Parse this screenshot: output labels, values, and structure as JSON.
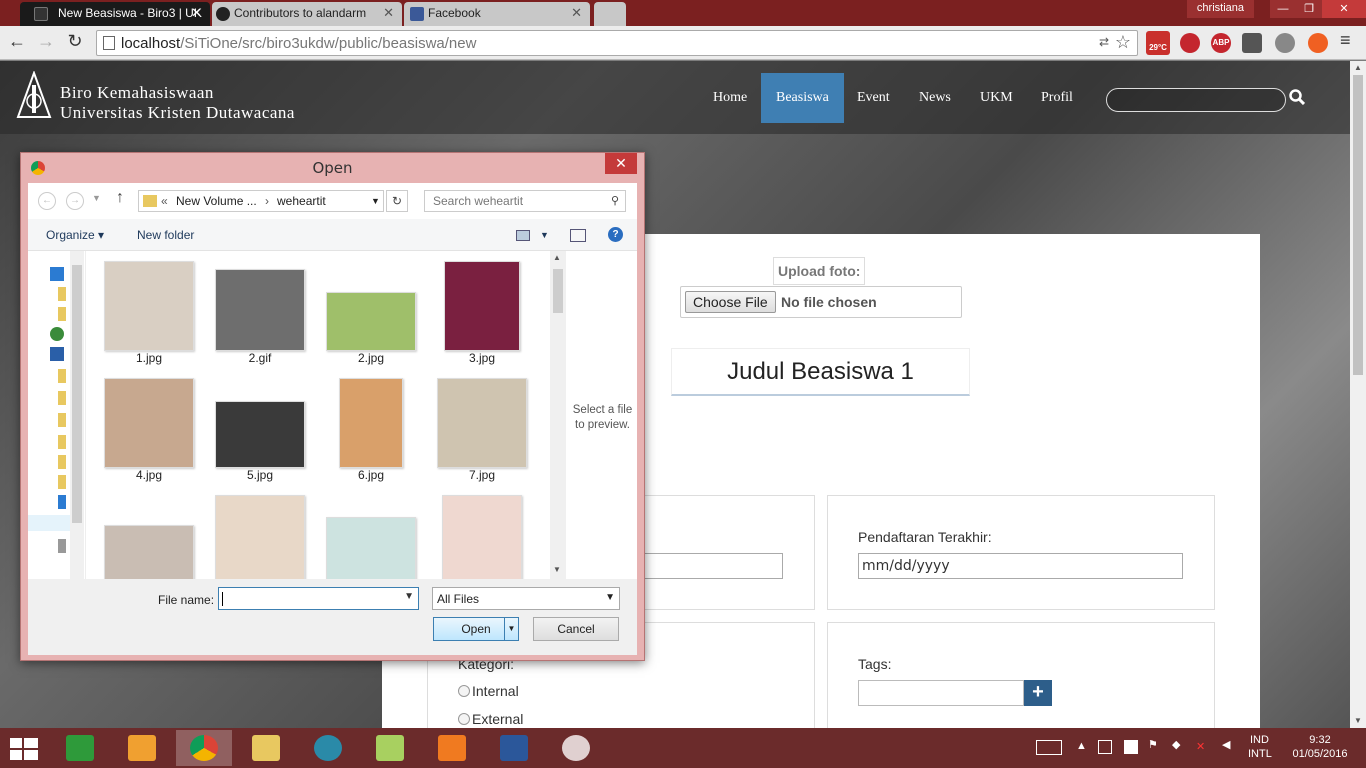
{
  "browser": {
    "tabs": [
      {
        "title": "New Beasiswa - Biro3 | UK",
        "active": true
      },
      {
        "title": "Contributors to alandarm",
        "active": false
      },
      {
        "title": "Facebook",
        "active": false
      }
    ],
    "tab_close": "✕",
    "user": "christiana",
    "window_buttons": {
      "minimize": "—",
      "restore": "❐",
      "close": "✕"
    },
    "nav": {
      "back": "←",
      "forward": "→",
      "reload": "↻"
    },
    "url_host": "localhost",
    "url_path": "/SiTiOne/src/biro3ukdw/public/beasiswa/new",
    "star": "☆",
    "translate": "⇄",
    "extensions": {
      "weather": "29°C",
      "abp": "ABP"
    },
    "menu": "≡"
  },
  "site": {
    "brand_line1": "Biro Kemahasiswaan",
    "brand_line2": "Universitas Kristen Dutawacana",
    "nav": [
      "Home",
      "Beasiswa",
      "Event",
      "News",
      "UKM",
      "Profil"
    ],
    "active_nav": "Beasiswa",
    "upload_label": "Upload foto:",
    "choose_file": "Choose File",
    "no_file": "No file chosen",
    "judul": "Judul Beasiswa 1",
    "pendaftaran_label": "Pendaftaran Terakhir:",
    "date_placeholder": "mm/dd/yyyy",
    "kategori_label": "Kategori:",
    "kategori_options": [
      "Internal",
      "External"
    ],
    "tags_label": "Tags:",
    "tags_add": "+"
  },
  "dialog": {
    "title": "Open",
    "close": "✕",
    "path": [
      "«",
      "New Volume ...",
      "›",
      "weheartit"
    ],
    "search_placeholder": "Search weheartit",
    "organize": "Organize ▾",
    "new_folder": "New folder",
    "help": "?",
    "files": [
      {
        "name": "1.jpg",
        "color": "#d9cfc3"
      },
      {
        "name": "2.gif",
        "color": "#6e6e6e"
      },
      {
        "name": "2.jpg",
        "color": "#9fbf6a"
      },
      {
        "name": "3.jpg",
        "color": "#7a2040"
      },
      {
        "name": "4.jpg",
        "color": "#c7a88f"
      },
      {
        "name": "5.jpg",
        "color": "#3a3a3a"
      },
      {
        "name": "6.jpg",
        "color": "#d9a06a"
      },
      {
        "name": "7.jpg",
        "color": "#cfc4b0"
      },
      {
        "name": "",
        "color": "#c9bdb3"
      },
      {
        "name": "",
        "color": "#e8d8c8"
      },
      {
        "name": "",
        "color": "#cde3e0"
      },
      {
        "name": "",
        "color": "#efd8d0"
      }
    ],
    "preview_text": "Select a file to preview.",
    "file_name_label": "File name:",
    "file_name_value": "",
    "file_type": "All Files",
    "open_button": "Open",
    "cancel_button": "Cancel"
  },
  "taskbar": {
    "language": "IND",
    "language2": "INTL",
    "time": "9:32",
    "date": "01/05/2016"
  }
}
